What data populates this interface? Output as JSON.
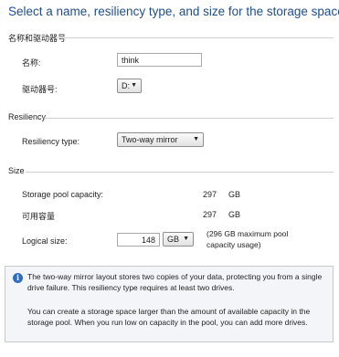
{
  "heading": "Select a name, resiliency type, and size for the storage space",
  "name_group": {
    "title": "名称和驱动器号",
    "name_label": "名称:",
    "name_value": "think",
    "drive_label": "驱动器号:",
    "drive_value": "D:"
  },
  "resiliency_group": {
    "title": "Resiliency",
    "type_label": "Resiliency type:",
    "type_value": "Two-way mirror"
  },
  "size_group": {
    "title": "Size",
    "pool_capacity_label": "Storage pool capacity:",
    "pool_capacity_value": "297",
    "pool_capacity_unit": "GB",
    "available_label": "可用容量",
    "available_value": "297",
    "available_unit": "GB",
    "logical_label": "Logical size:",
    "logical_value": "148",
    "logical_unit": "GB",
    "max_note": "(296 GB maximum pool capacity usage)"
  },
  "info": {
    "paragraph1": "The two-way mirror layout stores two copies of your data, protecting you from a single drive failure. This resiliency type requires at least two drives.",
    "paragraph2": "You can create a storage space larger than the amount of available capacity in the storage pool. When you run low on capacity in the pool, you can add more drives."
  },
  "icons": {
    "dropdown": "chevron-down-icon",
    "info": "info-icon"
  }
}
